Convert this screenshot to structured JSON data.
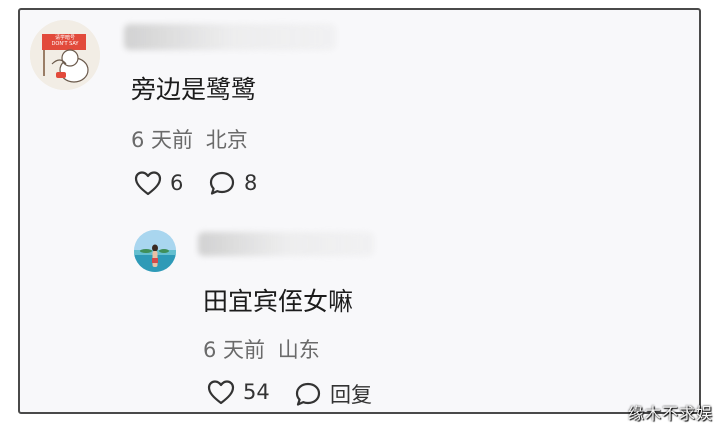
{
  "comments": [
    {
      "text": "旁边是鹭鹭",
      "time": "6 天前",
      "location": "北京",
      "likes": "6",
      "replies": "8"
    },
    {
      "text": "田宜宾侄女嘛",
      "time": "6 天前",
      "location": "山东",
      "likes": "54",
      "reply_label": "回复"
    }
  ],
  "avatar1_sign": {
    "line1": "请学暗号",
    "line2": "DON'T SAY"
  },
  "watermark": "缘木不求娱",
  "colors": {
    "background": "#f8f8fa",
    "text": "#1c1c1c",
    "meta": "#6a6a6a",
    "icon": "#333333"
  },
  "icons": [
    "heart-icon",
    "comment-bubble-icon"
  ]
}
